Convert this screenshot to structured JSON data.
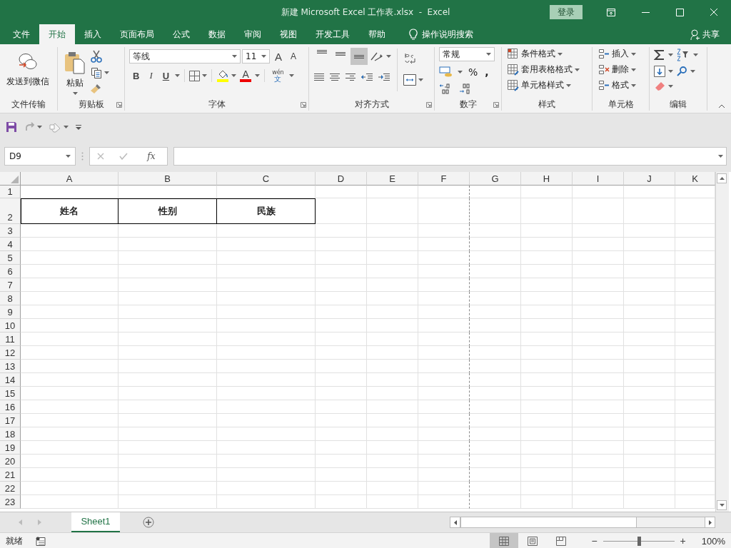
{
  "window": {
    "title": "新建 Microsoft Excel 工作表.xlsx  -  Excel",
    "sign_in": "登录"
  },
  "menu_tabs": [
    {
      "label": "文件",
      "selected": false
    },
    {
      "label": "开始",
      "selected": true
    },
    {
      "label": "插入",
      "selected": false
    },
    {
      "label": "页面布局",
      "selected": false
    },
    {
      "label": "公式",
      "selected": false
    },
    {
      "label": "数据",
      "selected": false
    },
    {
      "label": "审阅",
      "selected": false
    },
    {
      "label": "视图",
      "selected": false
    },
    {
      "label": "开发工具",
      "selected": false
    },
    {
      "label": "帮助",
      "selected": false
    }
  ],
  "tell_me": "操作说明搜索",
  "share": "共享",
  "ribbon": {
    "groups": [
      {
        "kind": "wechat",
        "label": "文件传输",
        "launcher": false,
        "buttons": [
          "发送到微信"
        ]
      },
      {
        "kind": "clipboard",
        "label": "剪贴板",
        "launcher": true,
        "buttons": [
          "粘贴"
        ]
      },
      {
        "kind": "font",
        "label": "字体",
        "launcher": true,
        "font_name": "等线",
        "font_size": "11",
        "grow": "A",
        "shrink": "A",
        "bold": "B",
        "italic": "I",
        "underline": "U",
        "font_color": "A",
        "phonetic_top": "wén",
        "phonetic_bottom": "文"
      },
      {
        "kind": "alignment",
        "label": "对齐方式",
        "launcher": true,
        "vertical_align": [
          {
            "selected": false
          },
          {
            "selected": false
          },
          {
            "selected": true
          }
        ]
      },
      {
        "kind": "number",
        "label": "数字",
        "launcher": true,
        "format": "常规",
        "percent": "%",
        "comma": ","
      },
      {
        "kind": "styles",
        "label": "样式",
        "launcher": false,
        "buttons": [
          "条件格式",
          "套用表格格式",
          "单元格样式"
        ]
      },
      {
        "kind": "cells",
        "label": "单元格",
        "launcher": false,
        "buttons": [
          "插入",
          "删除",
          "格式"
        ]
      },
      {
        "kind": "editing",
        "label": "编辑",
        "launcher": false
      }
    ]
  },
  "name_box": "D9",
  "fx": "fx",
  "sheet": {
    "columns": [
      "A",
      "B",
      "C",
      "D",
      "E",
      "F",
      "G",
      "H",
      "I",
      "J",
      "K"
    ],
    "rows": [
      {
        "number": "1"
      },
      {
        "number": "2",
        "cells": [
          "姓名",
          "性别",
          "民族"
        ]
      },
      {
        "number": "3"
      },
      {
        "number": "4"
      },
      {
        "number": "5"
      },
      {
        "number": "6"
      },
      {
        "number": "7"
      },
      {
        "number": "8"
      },
      {
        "number": "9"
      },
      {
        "number": "10"
      },
      {
        "number": "11"
      },
      {
        "number": "12"
      },
      {
        "number": "13"
      },
      {
        "number": "14"
      },
      {
        "number": "15"
      },
      {
        "number": "16"
      },
      {
        "number": "17"
      },
      {
        "number": "18"
      },
      {
        "number": "19"
      },
      {
        "number": "20"
      },
      {
        "number": "21"
      },
      {
        "number": "22"
      },
      {
        "number": "23"
      }
    ]
  },
  "sheet_tabs": [
    {
      "label": "Sheet1",
      "selected": true
    }
  ],
  "status": {
    "text": "就绪",
    "views": [
      {
        "selected": true
      },
      {
        "selected": false
      },
      {
        "selected": false
      }
    ],
    "zoom_out": "−",
    "zoom_in": "+",
    "level": 0.5,
    "zoom": "100%"
  }
}
